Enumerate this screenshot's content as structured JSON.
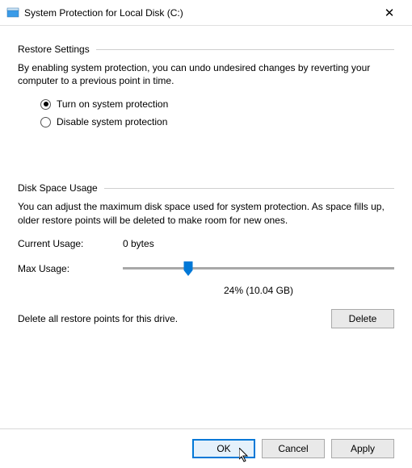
{
  "titlebar": {
    "title": "System Protection for Local Disk (C:)"
  },
  "sections": {
    "restore": {
      "header": "Restore Settings",
      "desc": "By enabling system protection, you can undo undesired changes by reverting your computer to a previous point in time.",
      "opt_on": "Turn on system protection",
      "opt_off": "Disable system protection"
    },
    "disk": {
      "header": "Disk Space Usage",
      "desc": "You can adjust the maximum disk space used for system protection. As space fills up, older restore points will be deleted to make room for new ones.",
      "current_label": "Current Usage:",
      "current_value": "0 bytes",
      "max_label": "Max Usage:",
      "slider_caption": "24% (10.04 GB)",
      "delete_text": "Delete all restore points for this drive.",
      "delete_btn": "Delete"
    }
  },
  "footer": {
    "ok": "OK",
    "cancel": "Cancel",
    "apply": "Apply"
  }
}
